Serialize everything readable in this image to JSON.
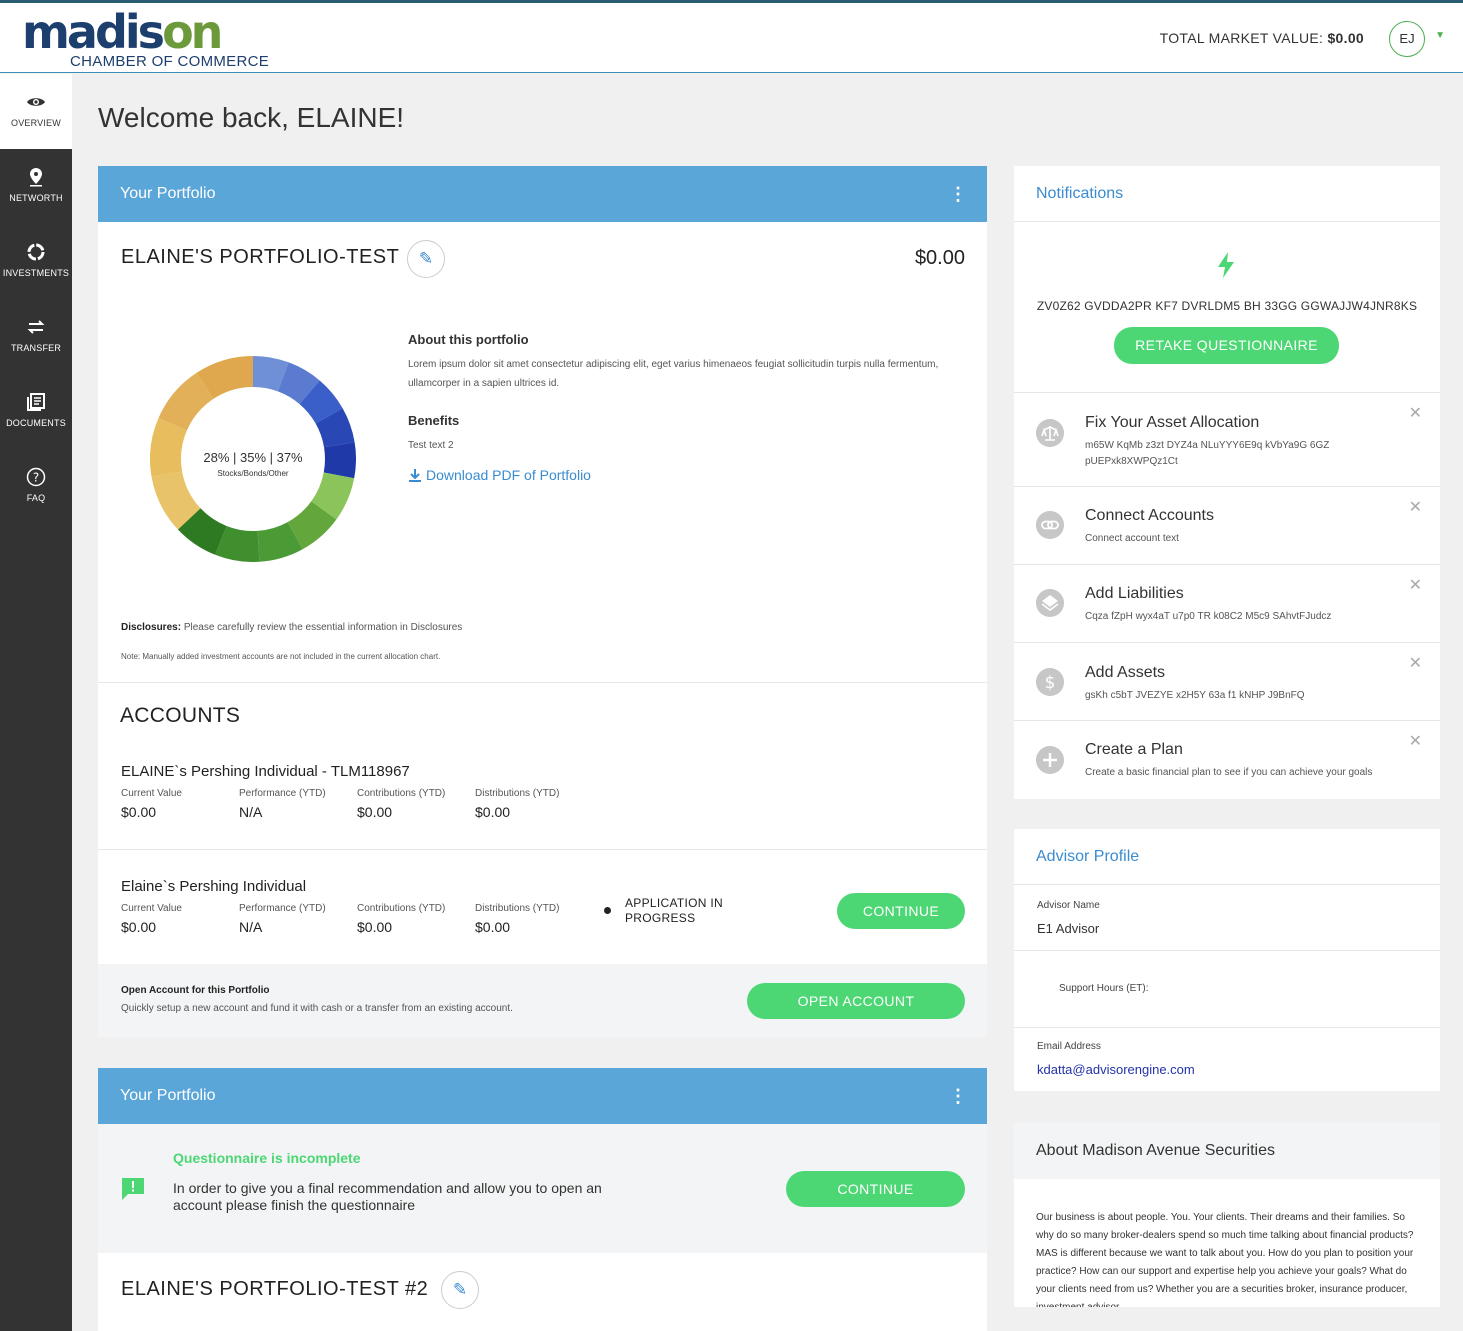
{
  "brand": {
    "word_part1": "madis",
    "word_part2": "on",
    "subtitle": "CHAMBER OF COMMERCE",
    "accent_blue": "#1d3f6e",
    "accent_green": "#6c9a3a"
  },
  "header": {
    "market_label": "TOTAL MARKET VALUE:",
    "market_value": "$0.00",
    "avatar_initials": "EJ"
  },
  "sidebar": {
    "items": [
      {
        "label": "OVERVIEW",
        "icon": "eye-icon"
      },
      {
        "label": "NETWORTH",
        "icon": "map-pin-icon"
      },
      {
        "label": "INVESTMENTS",
        "icon": "refresh-circle-icon"
      },
      {
        "label": "TRANSFER",
        "icon": "transfer-arrows-icon"
      },
      {
        "label": "DOCUMENTS",
        "icon": "documents-icon"
      },
      {
        "label": "FAQ",
        "icon": "question-icon"
      }
    ]
  },
  "welcome": "Welcome back, ELAINE!",
  "portfolio1": {
    "header": "Your Portfolio",
    "name": "ELAINE'S PORTFOLIO-TEST",
    "value": "$0.00",
    "donut_pct": "28% | 35% | 37%",
    "donut_label": "Stocks/Bonds/Other",
    "allocation": {
      "stocks": 28,
      "bonds": 35,
      "other": 37
    },
    "about_title": "About this portfolio",
    "about_text": "Lorem ipsum dolor sit amet consectetur adipiscing elit, eget varius himenaeos feugiat sollicitudin turpis nulla fermentum, ullamcorper in a sapien ultrices id.",
    "benefits_title": "Benefits",
    "benefits_text": "Test text 2",
    "download_label": "Download PDF of Portfolio",
    "disclosures_label": "Disclosures:",
    "disclosures_text": "Please carefully review the essential information in Disclosures",
    "note_text": "Note: Manually added investment accounts are not included in the current allocation chart.",
    "accounts_title": "ACCOUNTS",
    "accounts": [
      {
        "name": "ELAINE`s Pershing Individual - TLM118967",
        "cols": [
          {
            "k": "Current Value",
            "v": "$0.00"
          },
          {
            "k": "Performance (YTD)",
            "v": "N/A"
          },
          {
            "k": "Contributions (YTD)",
            "v": "$0.00"
          },
          {
            "k": "Distributions (YTD)",
            "v": "$0.00"
          }
        ]
      },
      {
        "name": "Elaine`s Pershing Individual",
        "cols": [
          {
            "k": "Current Value",
            "v": "$0.00"
          },
          {
            "k": "Performance (YTD)",
            "v": "N/A"
          },
          {
            "k": "Contributions (YTD)",
            "v": "$0.00"
          },
          {
            "k": "Distributions (YTD)",
            "v": "$0.00"
          }
        ],
        "status_line1": "APPLICATION IN",
        "status_line2": "PROGRESS",
        "button": "CONTINUE"
      }
    ],
    "open_title": "Open Account for this Portfolio",
    "open_text": "Quickly setup a new account and fund it with cash or a transfer from an existing account.",
    "open_button": "OPEN ACCOUNT"
  },
  "portfolio2": {
    "header": "Your Portfolio",
    "q_title": "Questionnaire is incomplete",
    "q_text": "In order to give you a final recommendation and allow you to open an account please finish the questionnaire",
    "button": "CONTINUE",
    "name": "ELAINE'S PORTFOLIO-TEST #2"
  },
  "notifications": {
    "title": "Notifications",
    "code": "ZV0Z62 GVDDA2PR KF7 DVRLDM5 BH 33GG GGWAJJW4JNR8KS",
    "retake_button": "RETAKE QUESTIONNAIRE",
    "items": [
      {
        "title": "Fix Your Asset Allocation",
        "desc": "m65W KqMb z3zt DYZ4a NLuYYY6E9q kVbYa9G 6GZ pUEPxk8XWPQz1Ct",
        "icon": "balance-icon"
      },
      {
        "title": "Connect Accounts",
        "desc": "Connect account text",
        "icon": "link-icon"
      },
      {
        "title": "Add Liabilities",
        "desc": "Cqza fZpH wyx4aT u7p0 TR k08C2 M5c9 SAhvtFJudcz",
        "icon": "layers-icon"
      },
      {
        "title": "Add Assets",
        "desc": "gsKh c5bT JVEZYE x2H5Y 63a f1 kNHP J9BnFQ",
        "icon": "dollar-icon"
      },
      {
        "title": "Create a Plan",
        "desc": "Create a basic financial plan to see if you can achieve your goals",
        "icon": "plus-icon"
      }
    ]
  },
  "advisor": {
    "title": "Advisor Profile",
    "name_label": "Advisor Name",
    "name": "E1 Advisor",
    "hours_label": "Support Hours (ET):",
    "email_label": "Email Address",
    "email": "kdatta@advisorengine.com"
  },
  "about_firm": {
    "title": "About Madison Avenue Securities",
    "text": "Our business is about people. You. Your clients. Their dreams and their families. So why do so many broker-dealers spend so much time talking about financial products? MAS is different because we want to talk about you. How do you plan to position your practice? How can our support and expertise help you achieve your goals? What do your clients need from us? Whether you are a securities broker, insurance producer, investment advisor"
  }
}
